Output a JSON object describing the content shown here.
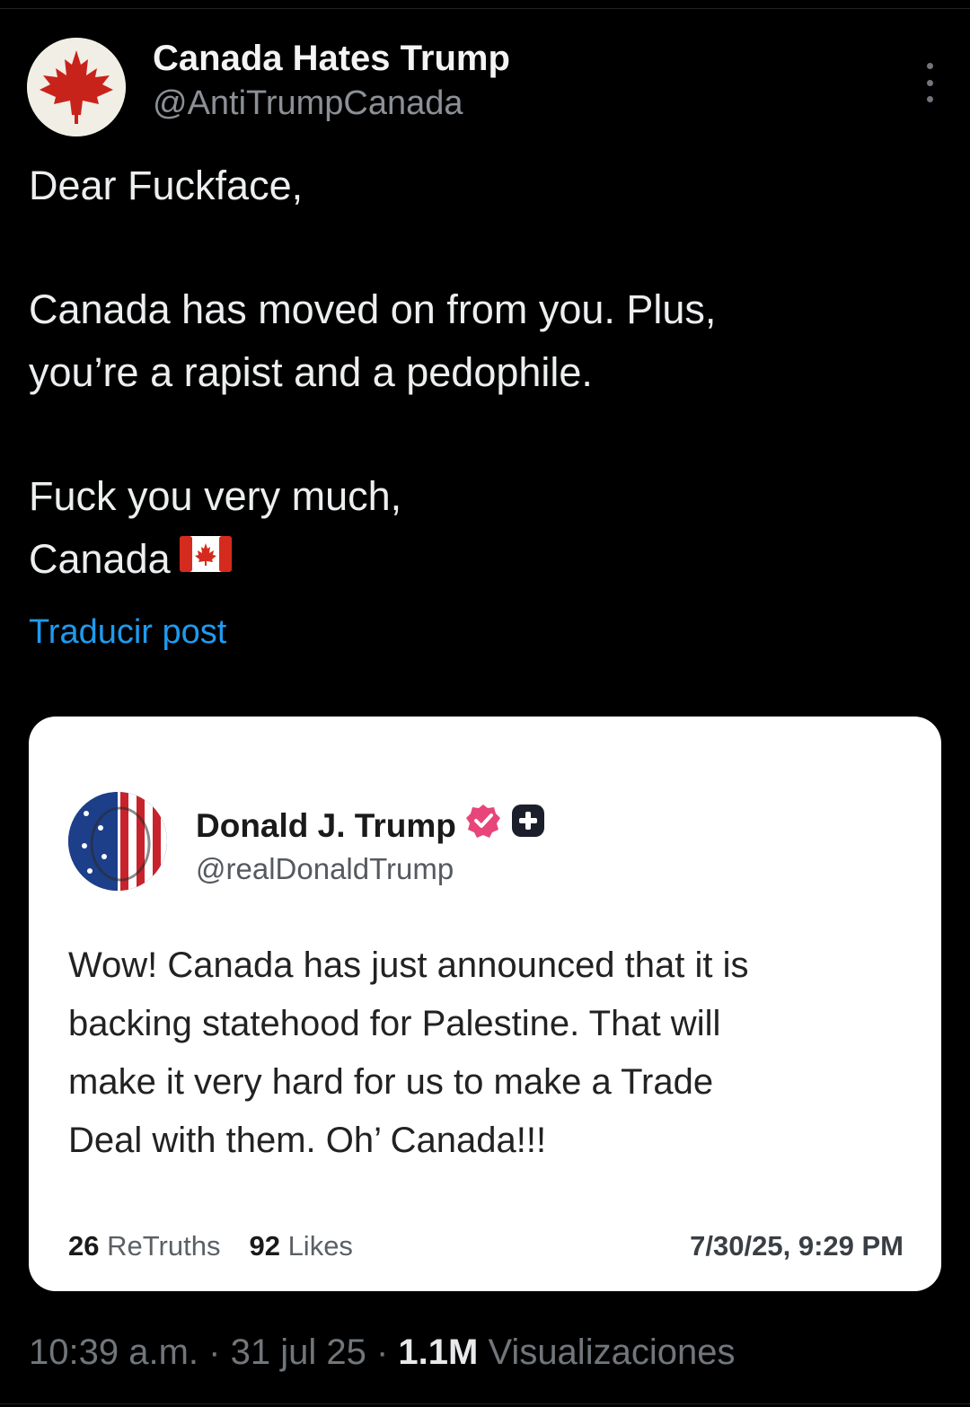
{
  "post": {
    "author": {
      "display_name": "Canada Hates Trump",
      "handle": "@AntiTrumpCanada",
      "avatar_icon": "canada-maple-leaf-avatar"
    },
    "more_icon": "more-options-icon",
    "body": {
      "greeting": "Dear Fuckface,",
      "line1": "Canada has moved on from you. Plus,",
      "line2": "you’re a rapist and a pedophile.",
      "closing": "Fuck you very much,",
      "signature": "Canada"
    },
    "signature_emoji": "canada-flag-icon",
    "translate_label": "Traducir post"
  },
  "quoted": {
    "author": {
      "display_name": "Donald J. Trump",
      "handle": "@realDonaldTrump",
      "avatar_icon": "flag-portrait-avatar",
      "verified_icon": "verified-badge-icon",
      "plus_icon": "plus-badge-icon"
    },
    "body": {
      "line1": "Wow! Canada has just announced that it is",
      "line2": "backing statehood for Palestine. That will",
      "line3": "make it very hard for us to make a Trade",
      "line4": "Deal with them. Oh’ Canada!!!"
    },
    "stats": {
      "retruths_count": "26",
      "retruths_label": "ReTruths",
      "likes_count": "92",
      "likes_label": "Likes",
      "date": "7/30/25, 9:29 PM"
    }
  },
  "footer": {
    "time": "10:39 a.m.",
    "sep1": "·",
    "date": "31 jul 25",
    "sep2": "·",
    "views_count": "1.1M",
    "views_label": "Visualizaciones"
  },
  "colors": {
    "background": "#000000",
    "link": "#1d9bf0",
    "muted": "#71767b",
    "verified": "#e8457a",
    "canada_red": "#d52b1e"
  }
}
